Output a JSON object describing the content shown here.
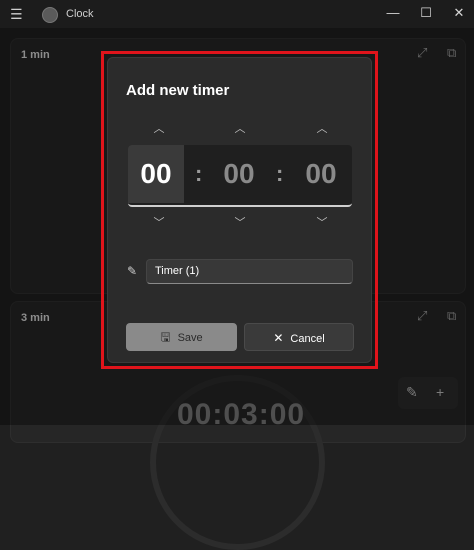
{
  "app": {
    "title": "Clock",
    "menu_icon": "hamburger-icon",
    "logo_icon": "clock-app-icon"
  },
  "window_controls": {
    "minimize": "—",
    "maximize": "☐",
    "close": "✕"
  },
  "timers": [
    {
      "title": "1 min"
    },
    {
      "title": "3 min",
      "display": "00:03:00"
    }
  ],
  "dialog": {
    "title": "Add new timer",
    "hours": "00",
    "minutes": "00",
    "seconds": "00",
    "separator": ":",
    "name_value": "Timer (1)",
    "save_label": "Save",
    "cancel_label": "Cancel"
  },
  "colors": {
    "highlight": "#e0141b",
    "dialog_bg": "#2b2b2b",
    "app_bg": "#202020"
  }
}
